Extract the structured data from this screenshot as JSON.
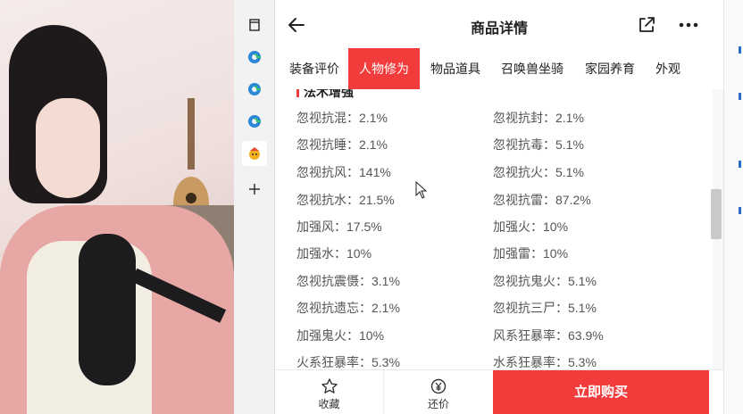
{
  "page": {
    "title": "商品详情"
  },
  "tabs": [
    {
      "label": "装备评价"
    },
    {
      "label": "人物修为"
    },
    {
      "label": "物品道具"
    },
    {
      "label": "召唤兽坐骑"
    },
    {
      "label": "家园养育"
    },
    {
      "label": "外观"
    }
  ],
  "active_tab": "人物修为",
  "section": {
    "title": "法术增强"
  },
  "stats": [
    [
      "忽视抗混：2.1%",
      "忽视抗封：2.1%"
    ],
    [
      "忽视抗睡：2.1%",
      "忽视抗毒：5.1%"
    ],
    [
      "忽视抗风：141%",
      "忽视抗火：5.1%"
    ],
    [
      "忽视抗水：21.5%",
      "忽视抗雷：87.2%"
    ],
    [
      "加强风：17.5%",
      "加强火：10%"
    ],
    [
      "加强水：10%",
      "加强雷：10%"
    ],
    [
      "忽视抗震慑：3.1%",
      "忽视抗鬼火：5.1%"
    ],
    [
      "忽视抗遗忘：2.1%",
      "忽视抗三尸：5.1%"
    ],
    [
      "加强鬼火：10%",
      "风系狂暴率：63.9%"
    ],
    [
      "火系狂暴率：5.3%",
      "水系狂暴率：5.3%"
    ]
  ],
  "bottom": {
    "favorite_label": "收藏",
    "offer_label": "还价",
    "buy_label": "立即购买"
  },
  "icons": {
    "back": "arrow-left-icon",
    "share": "share-icon",
    "more": "more-icon",
    "favorite": "star-icon",
    "offer": "yuan-coin-icon"
  },
  "colors": {
    "accent": "#f23b3b"
  }
}
